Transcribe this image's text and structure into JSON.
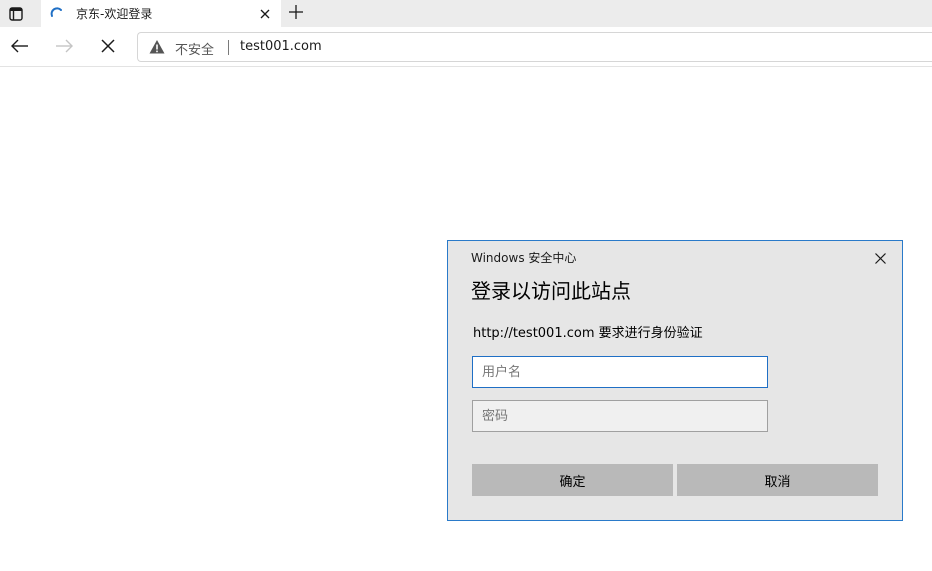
{
  "browser": {
    "tab": {
      "title": "京东-欢迎登录",
      "loading_icon": "loading-spinner-icon",
      "close_icon": "close-icon"
    },
    "new_tab_icon": "plus-icon",
    "tab_actions_icon": "tab-actions-icon",
    "toolbar": {
      "back_icon": "back-arrow-icon",
      "forward_icon": "forward-arrow-icon",
      "stop_icon": "stop-icon"
    },
    "address_bar": {
      "security_icon": "warning-triangle-icon",
      "security_text": "不安全",
      "url": "test001.com"
    }
  },
  "dialog": {
    "caption": "Windows 安全中心",
    "heading": "登录以访问此站点",
    "message": "http://test001.com 要求进行身份验证",
    "username_placeholder": "用户名",
    "password_placeholder": "密码",
    "ok_label": "确定",
    "cancel_label": "取消",
    "close_icon": "close-icon"
  },
  "colors": {
    "accent": "#2a7ac9",
    "loading": "#1f6fc5",
    "dialog_bg": "#e6e6e6",
    "button_bg": "#b9b9b9"
  }
}
